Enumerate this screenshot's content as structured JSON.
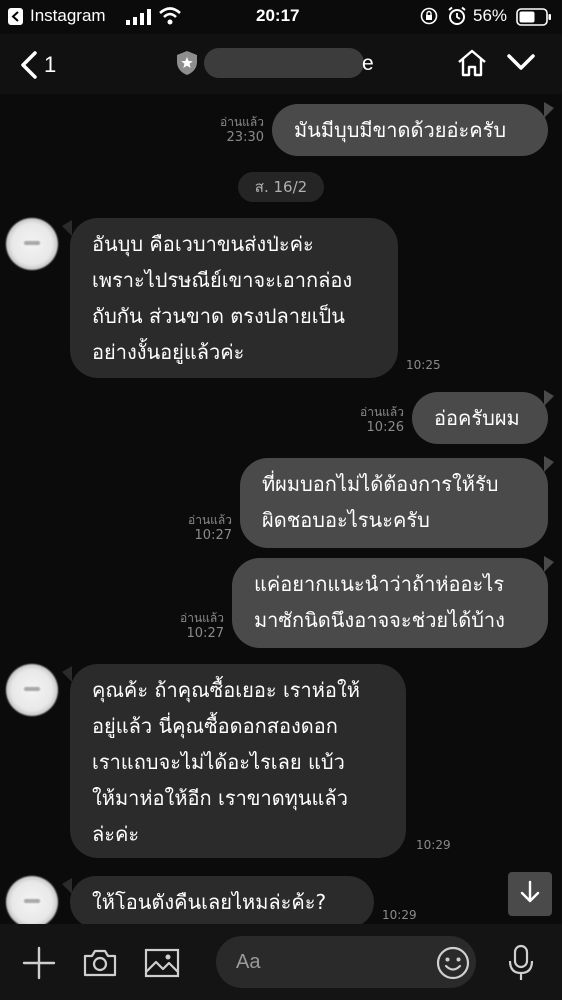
{
  "status_bar": {
    "app_name": "Instagram",
    "time": "20:17",
    "battery_percent": "56%"
  },
  "header": {
    "back_count": "1",
    "contact_name_visible_tail": "e"
  },
  "chat": {
    "date_divider": "ส. 16/2",
    "read_label": "อ่านแล้ว",
    "messages": [
      {
        "dir": "out",
        "text": "มันมีบุบมีขาดด้วยอ่ะครับ",
        "time": "23:30",
        "read": true
      },
      {
        "dir": "in",
        "lines": [
          "อันบุบ คือเวบาขนส่งป่ะค่ะ",
          "เพราะไปรษณีย์เขาจะเอากล่อง",
          "ถับกัน ส่วนขาด ตรงปลายเป็น",
          "อย่างงั้นอยู่แล้วค่ะ"
        ],
        "time": "10:25"
      },
      {
        "dir": "out",
        "text": "อ่อครับผม",
        "time": "10:26",
        "read": true
      },
      {
        "dir": "out",
        "lines": [
          "ที่ผมบอกไม่ได้ต้องการให้รับ",
          "ผิดชอบอะไรนะครับ"
        ],
        "time": "10:27",
        "read": true
      },
      {
        "dir": "out",
        "lines": [
          "แค่อยากแนะนำว่าถ้าห่ออะไร",
          "มาซักนิดนึงอาจจะช่วยได้บ้าง"
        ],
        "time": "10:27",
        "read": true
      },
      {
        "dir": "in",
        "lines": [
          "คุณค้ะ ถ้าคุณซื้อเยอะ เราห่อให้",
          "อยู่แล้ว นี่คุณซื้อดอกสองดอก",
          "เราแถบจะไม่ได้อะไรเลย แบ้ว",
          "ให้มาห่อให้อีก เราขาดทุนแล้ว",
          "ล่ะค่ะ"
        ],
        "time": "10:29"
      },
      {
        "dir": "in",
        "text": "ให้โอนตังคืนเลยไหมล่ะค้ะ?",
        "time": "10:29"
      }
    ]
  },
  "composer": {
    "placeholder": "Aa"
  },
  "colors": {
    "background": "#0b0b0b",
    "bubble_out": "#4a4a4a",
    "bubble_in": "#2b2b2b"
  }
}
